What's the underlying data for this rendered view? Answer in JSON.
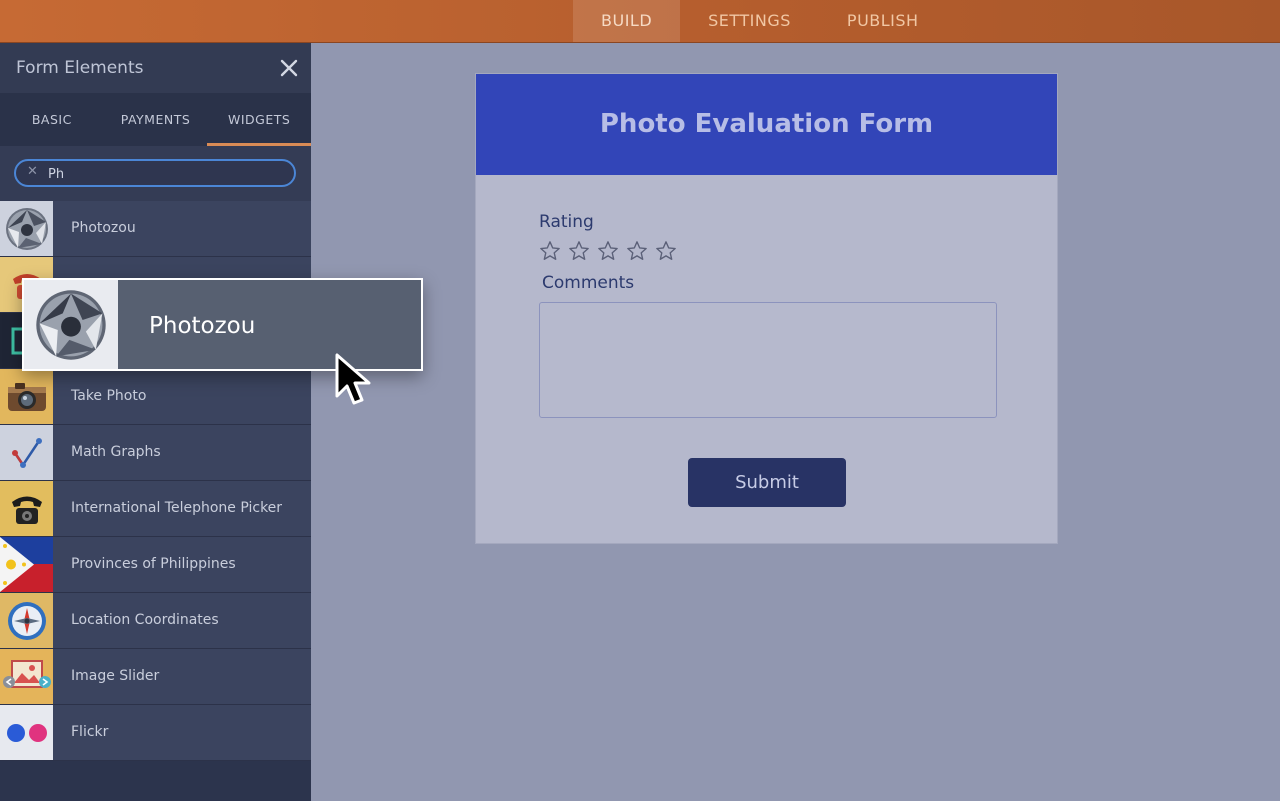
{
  "topnav": {
    "tabs": [
      "BUILD",
      "SETTINGS",
      "PUBLISH"
    ],
    "active": "BUILD"
  },
  "sidebar": {
    "title": "Form Elements",
    "tabs": [
      "BASIC",
      "PAYMENTS",
      "WIDGETS"
    ],
    "active_tab": "WIDGETS",
    "search": {
      "value": "Ph"
    },
    "items": [
      {
        "label": "Photozou",
        "icon": "photozou-aperture-icon"
      },
      {
        "label": "",
        "icon": "red-telephone-icon"
      },
      {
        "label": "",
        "icon": "frame-icon"
      },
      {
        "label": "Take Photo",
        "icon": "camera-icon"
      },
      {
        "label": "Math Graphs",
        "icon": "graph-icon"
      },
      {
        "label": "International Telephone Picker",
        "icon": "black-telephone-icon"
      },
      {
        "label": "Provinces of Philippines",
        "icon": "philippines-flag-icon"
      },
      {
        "label": "Location Coordinates",
        "icon": "compass-icon"
      },
      {
        "label": "Image Slider",
        "icon": "image-slider-icon"
      },
      {
        "label": "Flickr",
        "icon": "flickr-icon"
      }
    ]
  },
  "drag_ghost": {
    "label": "Photozou",
    "icon": "photozou-aperture-icon"
  },
  "form": {
    "title": "Photo Evaluation Form",
    "rating_label": "Rating",
    "rating_stars": 5,
    "rating_value": 0,
    "comments_label": "Comments",
    "comments_value": "",
    "submit_label": "Submit"
  },
  "colors": {
    "topbar": "#b45d2d",
    "sidebar": "#2c344d",
    "form_header": "#3245b8",
    "submit": "#283365",
    "canvas": "#9197b0"
  }
}
